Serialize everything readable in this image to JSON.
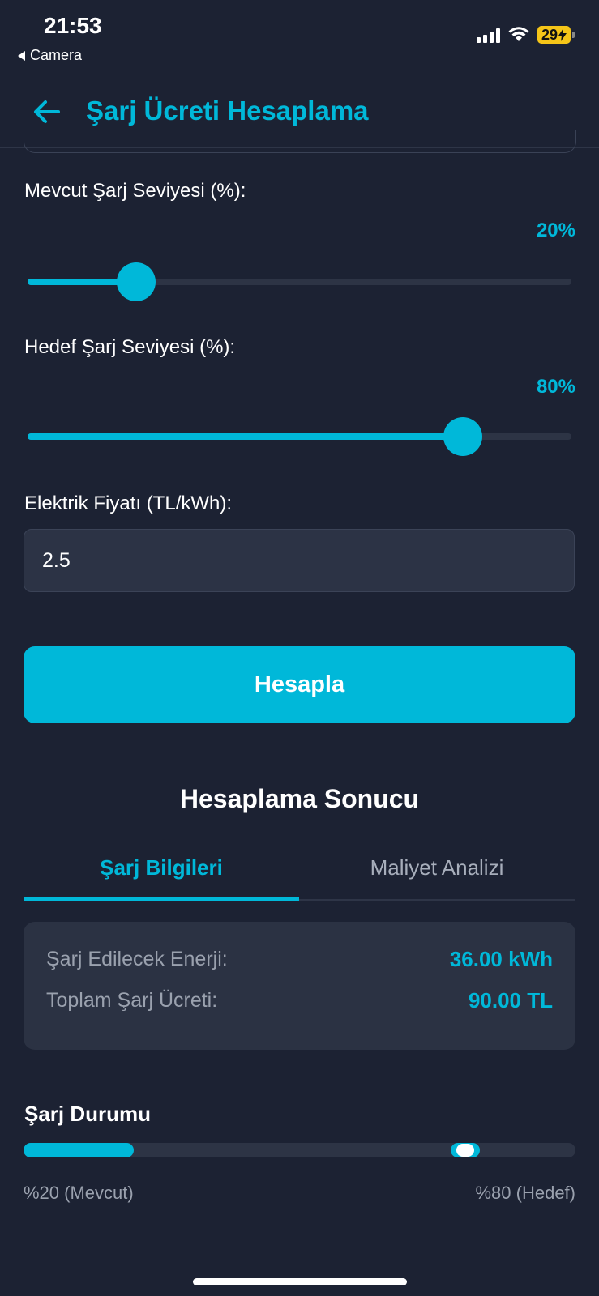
{
  "status_bar": {
    "time": "21:53",
    "back_app": "Camera",
    "battery": "29"
  },
  "header": {
    "title": "Şarj Ücreti Hesaplama"
  },
  "current_charge": {
    "label": "Mevcut Şarj Seviyesi (%):",
    "value_text": "20%",
    "value": 20
  },
  "target_charge": {
    "label": "Hedef Şarj Seviyesi (%):",
    "value_text": "80%",
    "value": 80
  },
  "price": {
    "label": "Elektrik Fiyatı (TL/kWh):",
    "value": "2.5"
  },
  "calculate_button": "Hesapla",
  "result": {
    "title": "Hesaplama Sonucu",
    "tabs": [
      {
        "label": "Şarj Bilgileri",
        "active": true
      },
      {
        "label": "Maliyet Analizi",
        "active": false
      }
    ],
    "rows": [
      {
        "label": "Şarj Edilecek Enerji:",
        "value": "36.00 kWh"
      },
      {
        "label": "Toplam Şarj Ücreti:",
        "value": "90.00 TL"
      }
    ]
  },
  "charge_status": {
    "title": "Şarj Durumu",
    "current_label": "%20 (Mevcut)",
    "target_label": "%80 (Hedef)",
    "current": 20,
    "target": 80
  },
  "colors": {
    "accent": "#00b8d9",
    "background": "#1c2233",
    "card": "#2b3243"
  }
}
